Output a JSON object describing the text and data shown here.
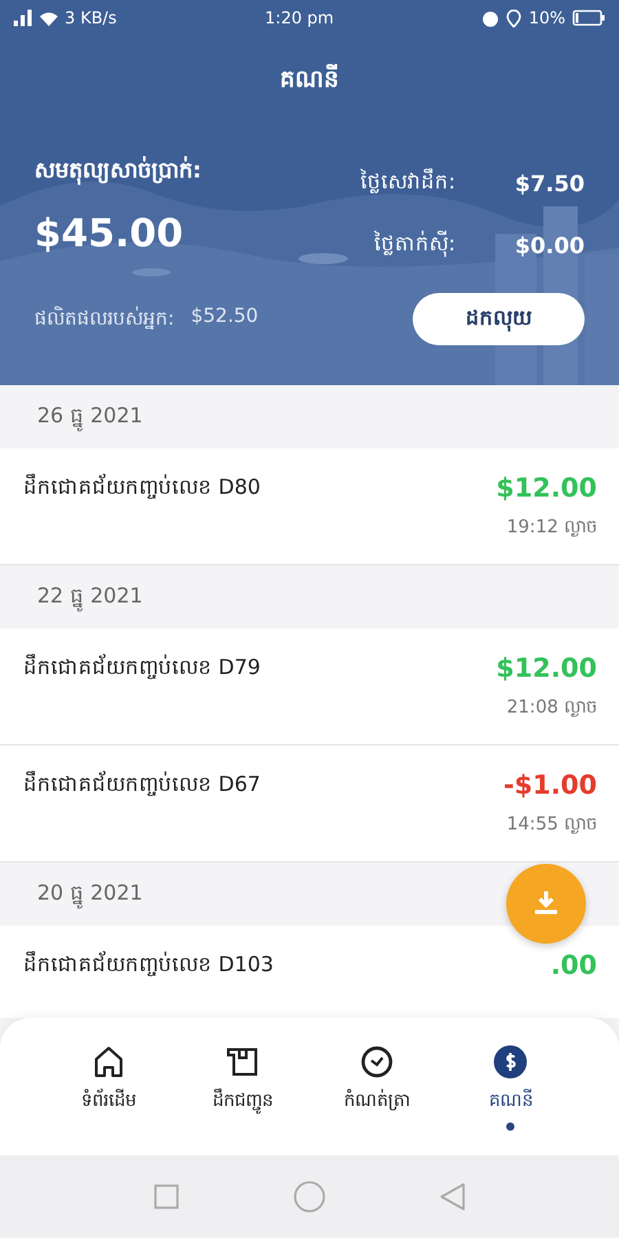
{
  "status_bar": {
    "speed": "3 KB/s",
    "time": "1:20 pm",
    "battery": "10%"
  },
  "header": {
    "title": "គណនី",
    "balance_label": "សមតុល្យសាច់ប្រាក់:",
    "balance": "$45.00",
    "fees": [
      {
        "label": "ថ្លៃសេវាដឹក:",
        "value": "$7.50"
      },
      {
        "label": "ថ្លៃតាក់ស៊ី:",
        "value": "$0.00"
      }
    ],
    "products_label": "ផលិតផលរបស់អ្នក:",
    "products_value": "$52.50",
    "withdraw_button": "ដកលុយ"
  },
  "groups": [
    {
      "date": "26 ធ្នូ 2021",
      "rows": [
        {
          "title": "ដឹកជោគជ័យកញ្ចប់លេខ D80",
          "amount": "$12.00",
          "kind": "credit",
          "time": "19:12 ល្ងាច"
        }
      ]
    },
    {
      "date": "22 ធ្នូ 2021",
      "rows": [
        {
          "title": "ដឹកជោគជ័យកញ្ចប់លេខ D79",
          "amount": "$12.00",
          "kind": "credit",
          "time": "21:08 ល្ងាច"
        },
        {
          "title": "ដឹកជោគជ័យកញ្ចប់លេខ D67",
          "amount": "-$1.00",
          "kind": "debit",
          "time": "14:55 ល្ងាច"
        }
      ]
    },
    {
      "date": "20 ធ្នូ 2021",
      "rows": [
        {
          "title": "ដឹកជោគជ័យកញ្ចប់លេខ D103",
          "amount": ".00",
          "kind": "credit"
        }
      ]
    }
  ],
  "nav": [
    {
      "label": "ទំព័រដើម",
      "selected": false
    },
    {
      "label": "ដឹកជញ្ជូន",
      "selected": false
    },
    {
      "label": "កំណត់ត្រា",
      "selected": false
    },
    {
      "label": "គណនី",
      "selected": true
    }
  ]
}
